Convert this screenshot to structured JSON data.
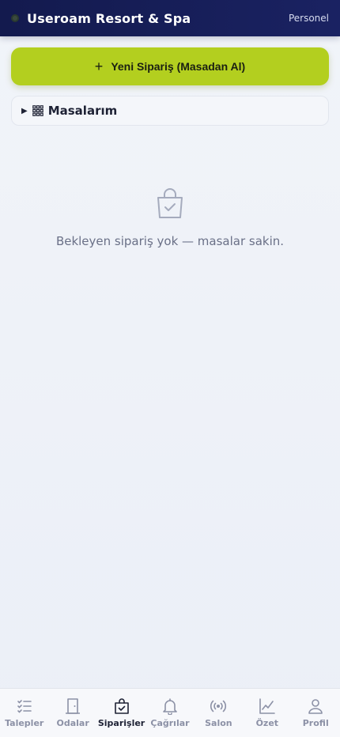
{
  "header": {
    "title": "Useroam Resort & Spa",
    "role": "Personel",
    "status_color": "#3b4a3e"
  },
  "actions": {
    "new_order_label": "Yeni Sipariş (Masadan Al)",
    "new_order_icon": "plus-icon",
    "accent_color": "#b3cf1f"
  },
  "tables": {
    "title": "Masalarım",
    "expanded": false
  },
  "empty_state": {
    "icon": "shopping-bag-check-icon",
    "message": "Bekleyen sipariş yok — masalar sakin."
  },
  "nav": {
    "items": [
      {
        "label": "Talepler",
        "icon": "list-check-icon",
        "active": false
      },
      {
        "label": "Odalar",
        "icon": "door-icon",
        "active": false
      },
      {
        "label": "Siparişler",
        "icon": "shopping-bag-icon",
        "active": true
      },
      {
        "label": "Çağrılar",
        "icon": "bell-icon",
        "active": false
      },
      {
        "label": "Salon",
        "icon": "broadcast-icon",
        "active": false
      },
      {
        "label": "Özet",
        "icon": "line-chart-icon",
        "active": false
      },
      {
        "label": "Profil",
        "icon": "user-icon",
        "active": false
      }
    ]
  }
}
